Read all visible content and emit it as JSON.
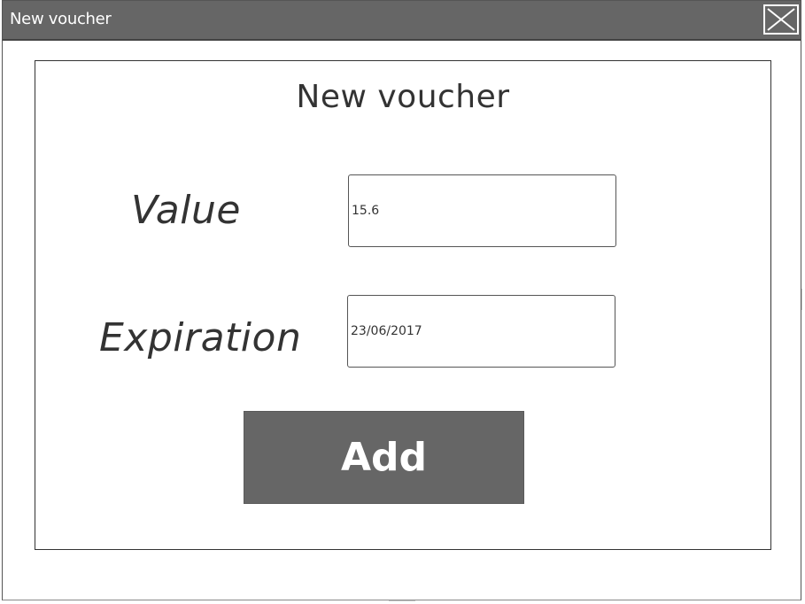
{
  "window": {
    "title": "New voucher",
    "close_icon": "close-icon"
  },
  "form": {
    "heading": "New voucher",
    "value_label": "Value",
    "value_input": "15.6",
    "expiration_label": "Expiration",
    "expiration_input": "23/06/2017",
    "add_label": "Add"
  },
  "colors": {
    "titlebar": "#666666",
    "button": "#666666",
    "text": "#333333"
  }
}
